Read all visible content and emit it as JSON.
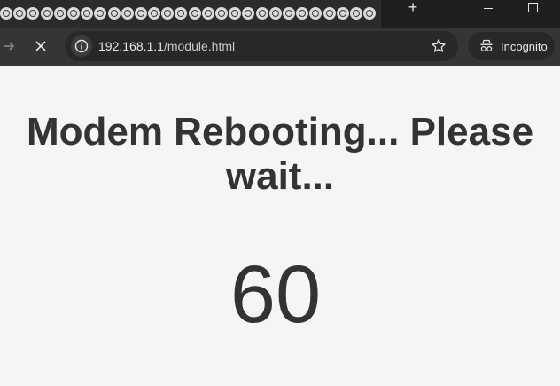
{
  "browser": {
    "address_bar": {
      "host": "192.168.1.1",
      "path": "/module.html"
    },
    "new_tab_label": "+",
    "incognito_label": "Incognito"
  },
  "icons": {
    "forward": "arrow-right-icon",
    "stop": "close-icon",
    "site_info": "info-icon",
    "bookmark": "star-icon",
    "incognito": "incognito-icon"
  },
  "page": {
    "title": "Modem Rebooting... Please wait...",
    "countdown": "60"
  },
  "colors": {
    "tabstrip_bg": "#1f1f1f",
    "toolbar_bg": "#353535",
    "omnibox_bg": "#282828",
    "page_bg": "#f5f5f5",
    "text": "#333333"
  }
}
